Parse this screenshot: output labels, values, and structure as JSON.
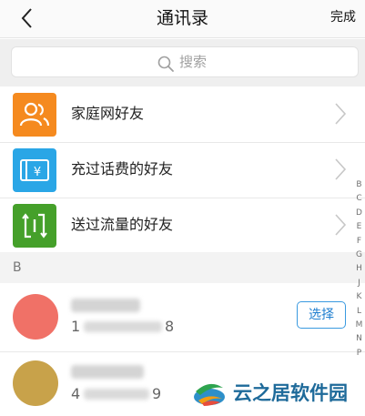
{
  "header": {
    "title": "通讯录",
    "done_label": "完成",
    "back_icon": "chevron-left-icon"
  },
  "search": {
    "placeholder": "搜索",
    "icon": "search-icon"
  },
  "features": [
    {
      "label": "家庭网好友",
      "icon": "family-users-icon",
      "color": "#f58a1f"
    },
    {
      "label": "充过话费的好友",
      "icon": "yen-recharge-icon",
      "color": "#2aa6e6"
    },
    {
      "label": "送过流量的好友",
      "icon": "data-transfer-icon",
      "color": "#45a02a"
    }
  ],
  "section": {
    "letter": "B"
  },
  "contacts": [
    {
      "phone_first": "1",
      "phone_last": "8",
      "avatar_color": "#f07167",
      "select_label": "选择"
    },
    {
      "phone_first": "4",
      "phone_last": "9",
      "avatar_color": "#c8a24a"
    }
  ],
  "alpha_index": [
    "B",
    "C",
    "D",
    "E",
    "F",
    "G",
    "H",
    "J",
    "K",
    "L",
    "M",
    "N",
    "P"
  ],
  "watermark": {
    "text": "云之居软件园"
  },
  "colors": {
    "accent": "#3a9ae0",
    "chevron": "#c7c7c7"
  }
}
